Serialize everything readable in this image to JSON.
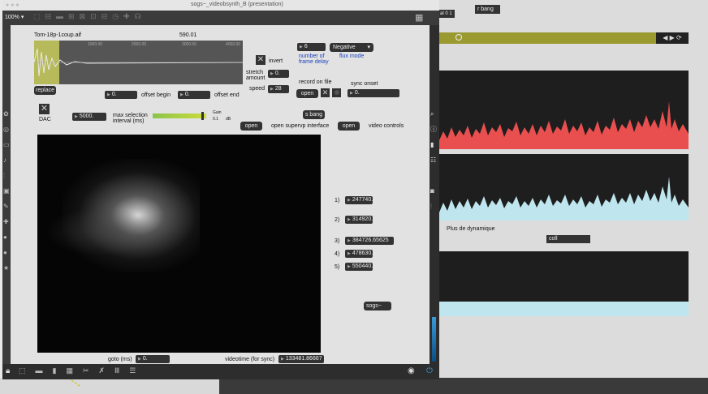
{
  "window": {
    "title": "sogs~_videobsynth_B (presentation)",
    "zoom": "100% ▾"
  },
  "file": {
    "name": "Tom-18p-1coup.aif",
    "duration": "590.01",
    "replace_label": "replace",
    "waveform_ticks": [
      "1000.00",
      "2000.00",
      "3000.00",
      "4000.00"
    ]
  },
  "controls": {
    "invert_label": "invert",
    "frame_delay_value": "6",
    "frame_delay_label_1": "number of",
    "frame_delay_label_2": "frame delay",
    "flux_mode_value": "Negative",
    "flux_mode_label": "flux mode",
    "stretch_label_1": "stretch",
    "stretch_label_2": "amount",
    "stretch_value": "0.",
    "speed_label": "speed",
    "speed_value": "28",
    "record_label": "record on file",
    "record_open": "open",
    "sync_onset_label": "sync onset",
    "sync_onset_value": "0.",
    "offset_begin_value": "0.",
    "offset_begin_label": "offset begin",
    "offset_end_value": "0.",
    "offset_end_label": "offset end",
    "dac_label": "DAC",
    "max_sel_value": "5000.",
    "max_sel_label_1": "max selection",
    "max_sel_label_2": "interval (ms)",
    "gain_label": "Gain",
    "gain_value": "0.1",
    "gain_unit": "dB",
    "sbang_label": "s bang",
    "open_supervp": "open",
    "supervp_label": "open supervp interface",
    "open_video": "open",
    "video_controls_label": "video controls",
    "goto_label": "goto (ms)",
    "goto_value": "0.",
    "videotime_label": "videotime (for sync)",
    "videotime_value": "133481.86667",
    "sogs_label": "sogs~"
  },
  "markers": [
    {
      "index": "1)",
      "value": "247740."
    },
    {
      "index": "2)",
      "value": "314920."
    },
    {
      "index": "3)",
      "value": "384726.65625"
    },
    {
      "index": "4)",
      "value": "478630."
    },
    {
      "index": "5)",
      "value": "550440."
    }
  ],
  "background_patch": {
    "top_label": "r bang",
    "top_left_fragment": "al 0 1",
    "plus_label": "Plus de dynamique",
    "coll_label": "coll"
  },
  "colors": {
    "red_wave": "#e94f4f",
    "cyan_wave": "#bfe6ee",
    "olive_bar": "#9a9a30",
    "scope_bg": "#1e1e1e"
  }
}
